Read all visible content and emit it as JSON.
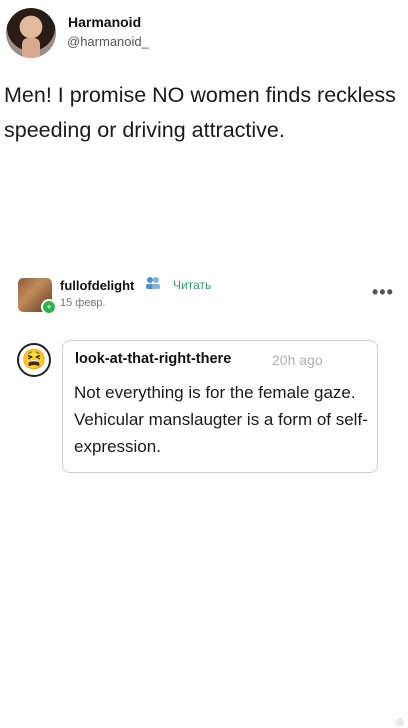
{
  "tweet": {
    "display_name": "Harmanoid",
    "handle": "@harmanoid_",
    "text": "Men! I promise NO women finds reckless speeding or driving attractive."
  },
  "comment": {
    "username": "fullofdelight",
    "follow_label": "Читать",
    "date": "15 февр.",
    "more_label": "•••",
    "user_icon": "people-icon"
  },
  "reply": {
    "username": "look-at-that-right-there",
    "time": "20h ago",
    "text": "Not everything is for the female gaze. Vehicular manslaugter is a form of self-expression."
  }
}
